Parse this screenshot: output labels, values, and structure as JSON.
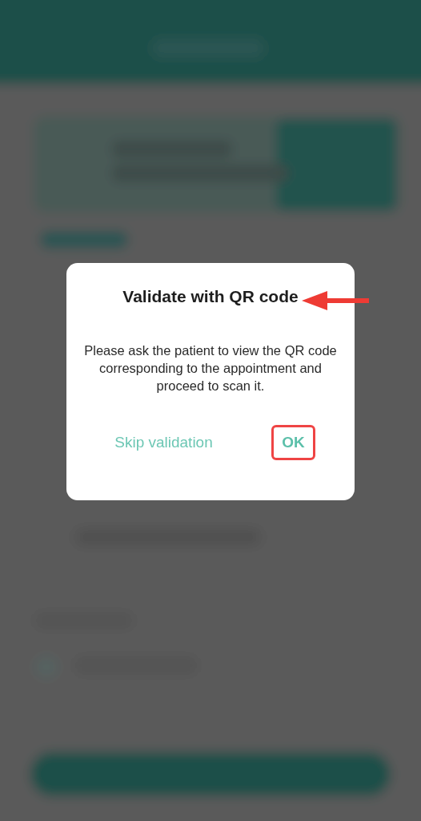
{
  "background": {
    "kind": "blurred-app"
  },
  "dialog": {
    "title": "Validate with QR code",
    "message": "Please ask the patient to view the QR code corresponding to the appointment and proceed to scan it.",
    "buttons": [
      {
        "label": "Skip validation",
        "kind": "secondary",
        "highlighted": false
      },
      {
        "label": "OK",
        "kind": "primary",
        "highlighted": true
      }
    ]
  },
  "annotations": {
    "title_arrow": true
  }
}
